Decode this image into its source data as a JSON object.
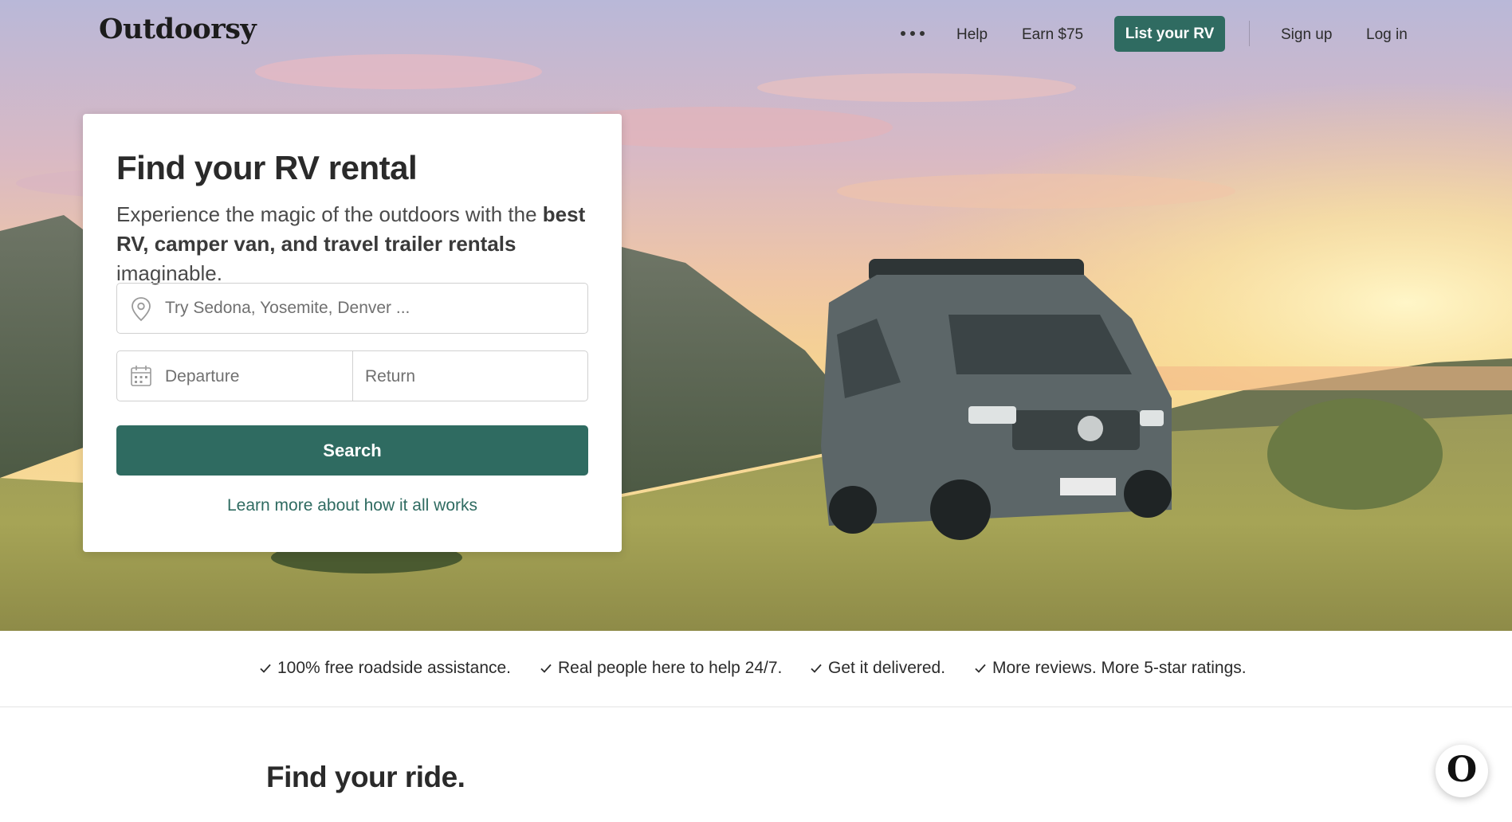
{
  "nav": {
    "logo": "Outdoorsy",
    "more_icon": "ellipsis-icon",
    "help": "Help",
    "earn": "Earn $75",
    "list_rv": "List your RV",
    "sign_up": "Sign up",
    "log_in": "Log in"
  },
  "search_card": {
    "title": "Find your RV rental",
    "subtitle_part1": "Experience the magic of the outdoors with the ",
    "subtitle_bold": "best RV, camper van, and travel trailer rentals",
    "subtitle_part2": " imaginable.",
    "location_placeholder": "Try Sedona, Yosemite, Denver ...",
    "location_icon": "map-pin-icon",
    "departure": "Departure",
    "return": "Return",
    "calendar_icon": "calendar-icon",
    "search_button": "Search",
    "learn_more": "Learn more about how it all works"
  },
  "benefits": [
    "100% free roadside assistance.",
    "Real people here to help 24/7.",
    "Get it delivered.",
    "More reviews. More 5-star ratings."
  ],
  "section": {
    "title": "Find your ride."
  },
  "float_button": {
    "icon": "outdoorsy-logo-icon",
    "glyph": "O"
  },
  "colors": {
    "brand_green": "#2f6b61",
    "text_dark": "#2b2b2b"
  }
}
